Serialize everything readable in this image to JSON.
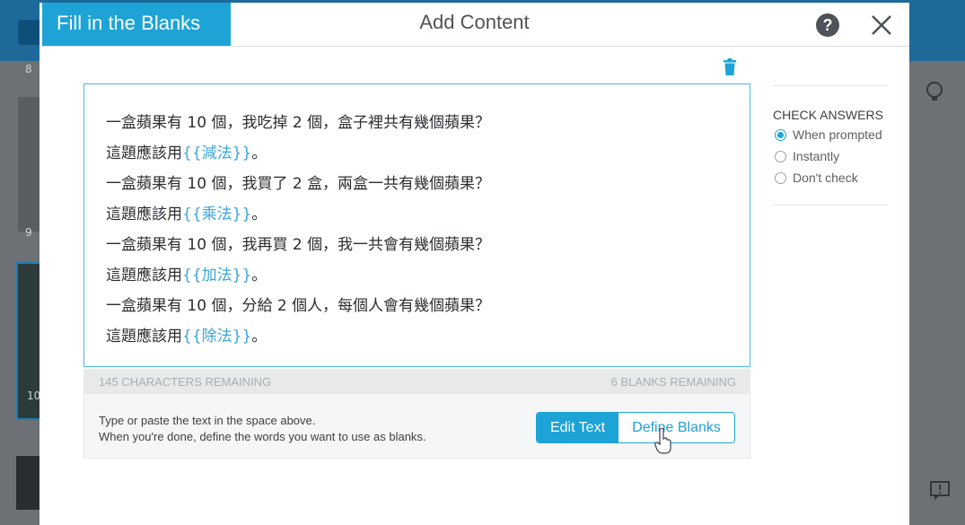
{
  "background": {
    "left_numbers": [
      "8",
      "9",
      "10"
    ]
  },
  "modal": {
    "type_tab": "Fill in the Blanks",
    "title": "Add Content"
  },
  "editor": {
    "lines": [
      {
        "text": "一盒蘋果有 10 個，我吃掉 2 個，盒子裡共有幾個蘋果？"
      },
      {
        "prefix": "這題應該用",
        "blank": "{{減法}}",
        "suffix": "。"
      },
      {
        "text": "一盒蘋果有 10 個，我買了 2 盒，兩盒一共有幾個蘋果？"
      },
      {
        "prefix": "這題應該用",
        "blank": "{{乘法}}",
        "suffix": "。"
      },
      {
        "text": "一盒蘋果有 10 個，我再買 2 個，我一共會有幾個蘋果？"
      },
      {
        "prefix": "這題應該用",
        "blank": "{{加法}}",
        "suffix": "。"
      },
      {
        "text": "一盒蘋果有 10 個，分給 2 個人，每個人會有幾個蘋果？"
      },
      {
        "prefix": "這題應該用",
        "blank": "{{除法}}",
        "suffix": "。"
      }
    ]
  },
  "counters": {
    "characters_remaining": "145 CHARACTERS REMAINING",
    "blanks_remaining": "6 BLANKS REMAINING"
  },
  "footer": {
    "instruction_1": "Type or paste the text in the space above.",
    "instruction_2": "When you're done, define the words you want to use as blanks.",
    "edit_text_label": "Edit Text",
    "define_blanks_label": "Define Blanks"
  },
  "check_answers": {
    "title": "CHECK ANSWERS",
    "options": [
      {
        "label": "When prompted",
        "selected": true
      },
      {
        "label": "Instantly",
        "selected": false
      },
      {
        "label": "Don't check",
        "selected": false
      }
    ]
  },
  "colors": {
    "accent": "#1ea3d6",
    "blank_text": "#3aa6d9",
    "text": "#2a2e32"
  }
}
